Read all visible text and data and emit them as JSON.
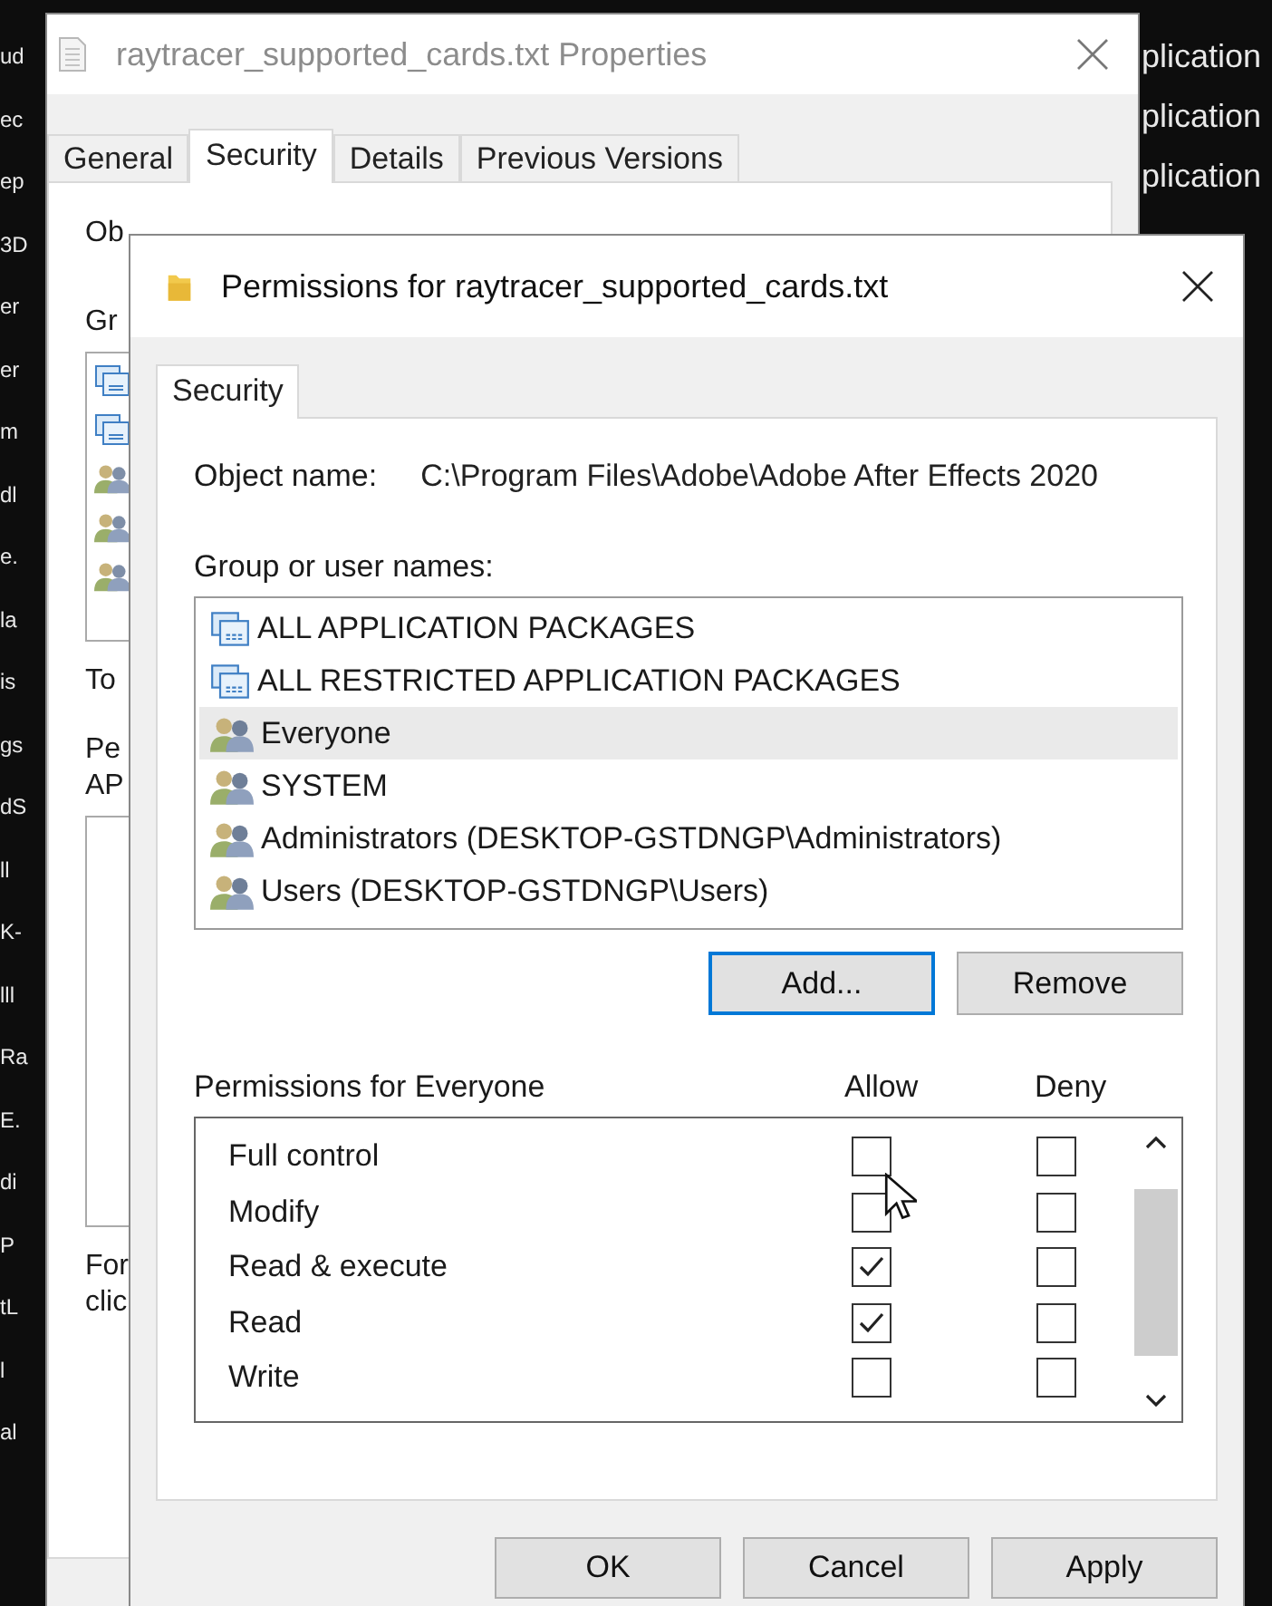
{
  "background": {
    "left_fragments": [
      "ud",
      "ec",
      "ep",
      "3D",
      "er",
      "er",
      "m",
      "dl",
      "e.",
      "la",
      "is",
      "gs",
      "dS",
      "ll",
      "K-",
      "lll",
      "Ra",
      "E.",
      "di",
      "P",
      "tL",
      "l",
      "al"
    ],
    "right_fragments": [
      "plication",
      "plication",
      "plication"
    ]
  },
  "properties_window": {
    "title": "raytracer_supported_cards.txt Properties",
    "tabs": [
      {
        "label": "General",
        "selected": false
      },
      {
        "label": "Security",
        "selected": true
      },
      {
        "label": "Details",
        "selected": false
      },
      {
        "label": "Previous Versions",
        "selected": false
      }
    ],
    "object_label": "Ob",
    "group_label": "Gr",
    "group_icons": [
      {
        "kind": "group"
      },
      {
        "kind": "group"
      },
      {
        "kind": "users"
      },
      {
        "kind": "users"
      },
      {
        "kind": "users"
      }
    ],
    "to_label": "To",
    "perm_label": [
      "Pe",
      "AP"
    ],
    "footer": [
      "For",
      "clic"
    ]
  },
  "permissions_dialog": {
    "title": "Permissions for raytracer_supported_cards.txt",
    "tabs": [
      {
        "label": "Security",
        "selected": true
      }
    ],
    "object_name_label": "Object name:",
    "object_name": "C:\\Program Files\\Adobe\\Adobe After Effects 2020",
    "group_label": "Group or user names:",
    "principals": [
      {
        "name": "ALL APPLICATION PACKAGES",
        "kind": "group",
        "selected": false
      },
      {
        "name": "ALL RESTRICTED APPLICATION PACKAGES",
        "kind": "group",
        "selected": false
      },
      {
        "name": "Everyone",
        "kind": "users",
        "selected": true
      },
      {
        "name": "SYSTEM",
        "kind": "users",
        "selected": false
      },
      {
        "name": "Administrators (DESKTOP-GSTDNGP\\Administrators)",
        "kind": "users",
        "selected": false
      },
      {
        "name": "Users (DESKTOP-GSTDNGP\\Users)",
        "kind": "users",
        "selected": false
      }
    ],
    "add_button": "Add...",
    "remove_button": "Remove",
    "permissions_label": "Permissions for Everyone",
    "allow_header": "Allow",
    "deny_header": "Deny",
    "permissions": [
      {
        "name": "Full control",
        "allow": false,
        "deny": false
      },
      {
        "name": "Modify",
        "allow": false,
        "deny": false
      },
      {
        "name": "Read & execute",
        "allow": true,
        "deny": false
      },
      {
        "name": "Read",
        "allow": true,
        "deny": false
      },
      {
        "name": "Write",
        "allow": false,
        "deny": false
      }
    ],
    "buttons": [
      "OK",
      "Cancel",
      "Apply"
    ]
  }
}
